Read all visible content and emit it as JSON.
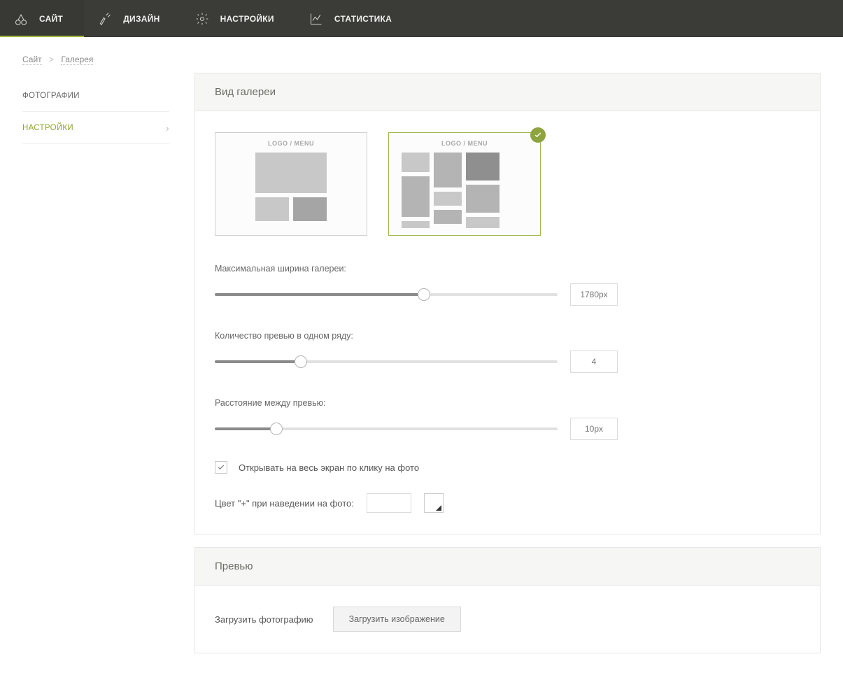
{
  "topnav": {
    "items": [
      {
        "label": "САЙТ",
        "icon_name": "site-icon"
      },
      {
        "label": "ДИЗАЙН",
        "icon_name": "design-icon"
      },
      {
        "label": "НАСТРОЙКИ",
        "icon_name": "settings-icon"
      },
      {
        "label": "СТАТИСТИКА",
        "icon_name": "stats-icon"
      }
    ]
  },
  "breadcrumb": {
    "items": [
      "Сайт",
      "Галерея"
    ]
  },
  "sidebar": {
    "items": [
      {
        "label": "ФОТОГРАФИИ"
      },
      {
        "label": "НАСТРОЙКИ"
      }
    ]
  },
  "panels": {
    "gallery_view": {
      "title": "Вид галереи",
      "layout_options": {
        "logo_menu_label": "LOGO / MENU",
        "selected_index": 1
      },
      "max_width": {
        "label": "Максимальная ширина галереи:",
        "value": "1780px",
        "fill_pct": 61
      },
      "preview_count": {
        "label": "Количество превью в одном ряду:",
        "value": "4",
        "fill_pct": 25
      },
      "preview_gap": {
        "label": "Расстояние между превью:",
        "value": "10px",
        "fill_pct": 18
      },
      "open_fullscreen": {
        "label": "Открывать на весь экран по клику на фото",
        "checked": true
      },
      "plus_color": {
        "label": "Цвет \"+\" при наведении на фото:"
      }
    },
    "preview": {
      "title": "Превью",
      "upload_label": "Загрузить фотографию",
      "upload_button": "Загрузить изображение"
    }
  }
}
